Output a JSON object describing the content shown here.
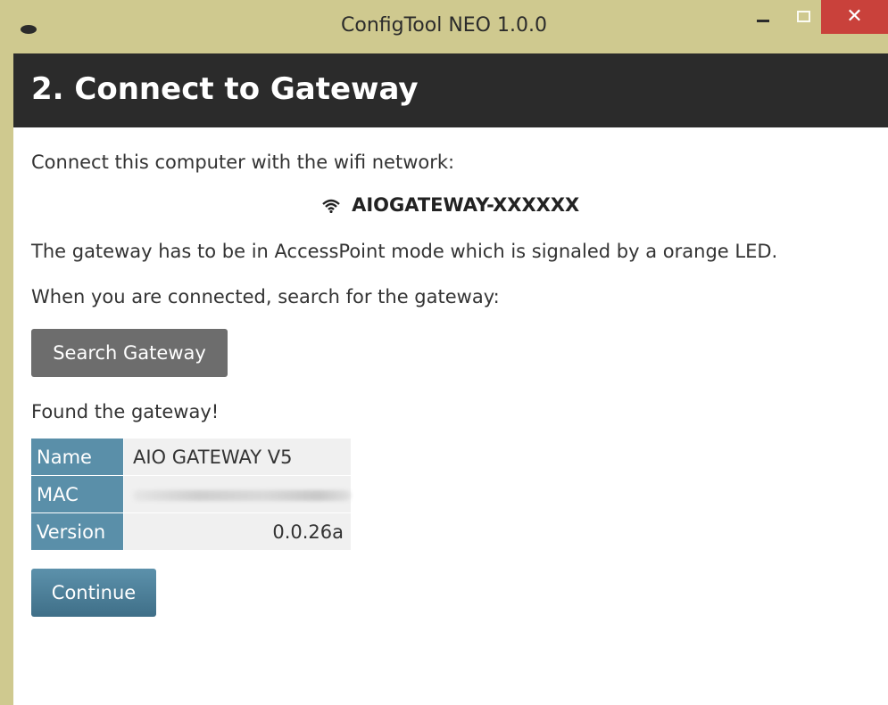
{
  "window": {
    "title": "ConfigTool NEO 1.0.0",
    "close_glyph": "✕",
    "icons": {
      "app": "app-icon",
      "minimize": "minimize-icon",
      "maximize": "maximize-icon",
      "close": "close-icon"
    }
  },
  "page": {
    "heading": "2. Connect to Gateway",
    "connect_instruction": "Connect this computer with the wifi network:",
    "network_name": "AIOGATEWAY-XXXXXX",
    "network_icon": "wifi-icon",
    "accesspoint_note": "The gateway has to be in AccessPoint mode which is signaled by a orange LED.",
    "search_instruction": "When you are connected, search for the gateway:",
    "search_button": "Search Gateway",
    "found_message": "Found the gateway!",
    "info": {
      "name_label": "Name",
      "name_value": "AIO GATEWAY V5",
      "mac_label": "MAC",
      "version_label": "Version",
      "version_value": "0.0.26a"
    },
    "continue_button": "Continue"
  },
  "colors": {
    "titlebar": "#cfc98f",
    "header_bg": "#2b2b2b",
    "close_button": "#c9413b",
    "search_button": "#6d6d6d",
    "accent": "#5a8fa9"
  }
}
